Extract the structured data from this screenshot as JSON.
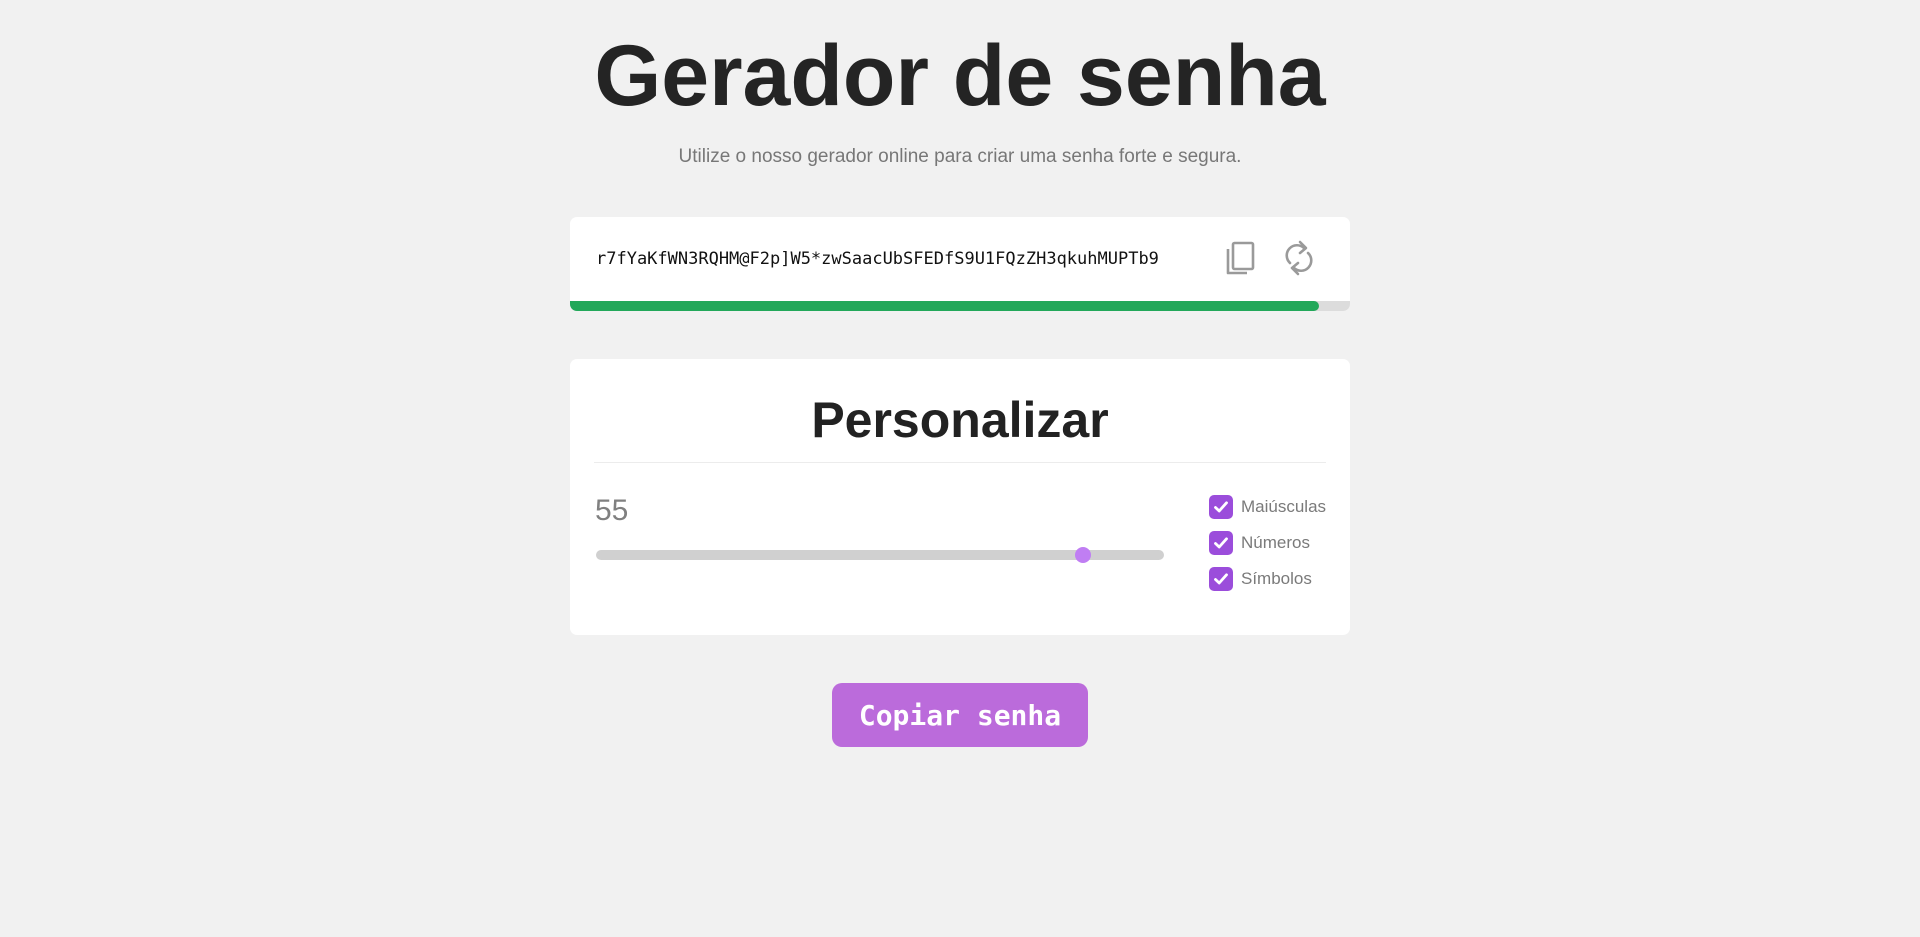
{
  "header": {
    "title": "Gerador de senha",
    "subtitle": "Utilize o nosso gerador online para criar uma senha forte e segura."
  },
  "password": {
    "value": "r7fYaKfWN3RQHM@F2p]W5*zwSaacUbSFEDfS9U1FQzZH3qkuhMUPTb9",
    "copy_icon": "copy-icon",
    "refresh_icon": "refresh-icon",
    "strength_fraction": 0.96,
    "strength_color": "#22a85a"
  },
  "customize": {
    "title": "Personalizar",
    "length": "55",
    "slider_min": 1,
    "slider_max": 64,
    "slider_value": 55,
    "options": [
      {
        "label": "Maiúsculas",
        "checked": true
      },
      {
        "label": "Números",
        "checked": true
      },
      {
        "label": "Símbolos",
        "checked": true
      }
    ],
    "accent_color": "#9b4ddb"
  },
  "actions": {
    "copy_button_label": "Copiar senha",
    "button_color": "#bb6bdb"
  }
}
